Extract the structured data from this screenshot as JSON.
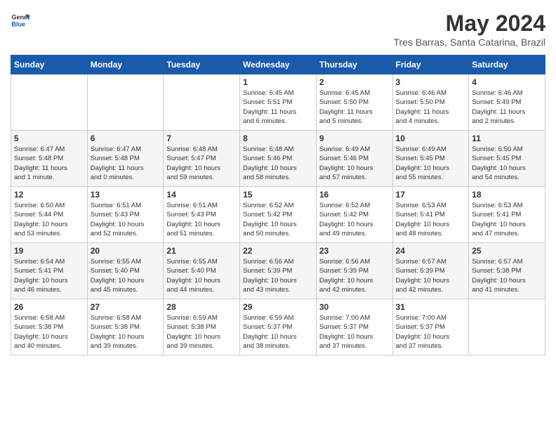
{
  "logo": {
    "text_general": "General",
    "text_blue": "Blue"
  },
  "title": "May 2024",
  "location": "Tres Barras, Santa Catarina, Brazil",
  "days_of_week": [
    "Sunday",
    "Monday",
    "Tuesday",
    "Wednesday",
    "Thursday",
    "Friday",
    "Saturday"
  ],
  "weeks": [
    [
      {
        "day": "",
        "info": ""
      },
      {
        "day": "",
        "info": ""
      },
      {
        "day": "",
        "info": ""
      },
      {
        "day": "1",
        "info": "Sunrise: 6:45 AM\nSunset: 5:51 PM\nDaylight: 11 hours\nand 6 minutes."
      },
      {
        "day": "2",
        "info": "Sunrise: 6:45 AM\nSunset: 5:50 PM\nDaylight: 11 hours\nand 5 minutes."
      },
      {
        "day": "3",
        "info": "Sunrise: 6:46 AM\nSunset: 5:50 PM\nDaylight: 11 hours\nand 4 minutes."
      },
      {
        "day": "4",
        "info": "Sunrise: 6:46 AM\nSunset: 5:49 PM\nDaylight: 11 hours\nand 2 minutes."
      }
    ],
    [
      {
        "day": "5",
        "info": "Sunrise: 6:47 AM\nSunset: 5:48 PM\nDaylight: 11 hours\nand 1 minute."
      },
      {
        "day": "6",
        "info": "Sunrise: 6:47 AM\nSunset: 5:48 PM\nDaylight: 11 hours\nand 0 minutes."
      },
      {
        "day": "7",
        "info": "Sunrise: 6:48 AM\nSunset: 5:47 PM\nDaylight: 10 hours\nand 59 minutes."
      },
      {
        "day": "8",
        "info": "Sunrise: 6:48 AM\nSunset: 5:46 PM\nDaylight: 10 hours\nand 58 minutes."
      },
      {
        "day": "9",
        "info": "Sunrise: 6:49 AM\nSunset: 5:46 PM\nDaylight: 10 hours\nand 57 minutes."
      },
      {
        "day": "10",
        "info": "Sunrise: 6:49 AM\nSunset: 5:45 PM\nDaylight: 10 hours\nand 55 minutes."
      },
      {
        "day": "11",
        "info": "Sunrise: 6:50 AM\nSunset: 5:45 PM\nDaylight: 10 hours\nand 54 minutes."
      }
    ],
    [
      {
        "day": "12",
        "info": "Sunrise: 6:50 AM\nSunset: 5:44 PM\nDaylight: 10 hours\nand 53 minutes."
      },
      {
        "day": "13",
        "info": "Sunrise: 6:51 AM\nSunset: 5:43 PM\nDaylight: 10 hours\nand 52 minutes."
      },
      {
        "day": "14",
        "info": "Sunrise: 6:51 AM\nSunset: 5:43 PM\nDaylight: 10 hours\nand 51 minutes."
      },
      {
        "day": "15",
        "info": "Sunrise: 6:52 AM\nSunset: 5:42 PM\nDaylight: 10 hours\nand 50 minutes."
      },
      {
        "day": "16",
        "info": "Sunrise: 6:52 AM\nSunset: 5:42 PM\nDaylight: 10 hours\nand 49 minutes."
      },
      {
        "day": "17",
        "info": "Sunrise: 6:53 AM\nSunset: 5:41 PM\nDaylight: 10 hours\nand 48 minutes."
      },
      {
        "day": "18",
        "info": "Sunrise: 6:53 AM\nSunset: 5:41 PM\nDaylight: 10 hours\nand 47 minutes."
      }
    ],
    [
      {
        "day": "19",
        "info": "Sunrise: 6:54 AM\nSunset: 5:41 PM\nDaylight: 10 hours\nand 46 minutes."
      },
      {
        "day": "20",
        "info": "Sunrise: 6:55 AM\nSunset: 5:40 PM\nDaylight: 10 hours\nand 45 minutes."
      },
      {
        "day": "21",
        "info": "Sunrise: 6:55 AM\nSunset: 5:40 PM\nDaylight: 10 hours\nand 44 minutes."
      },
      {
        "day": "22",
        "info": "Sunrise: 6:56 AM\nSunset: 5:39 PM\nDaylight: 10 hours\nand 43 minutes."
      },
      {
        "day": "23",
        "info": "Sunrise: 6:56 AM\nSunset: 5:39 PM\nDaylight: 10 hours\nand 42 minutes."
      },
      {
        "day": "24",
        "info": "Sunrise: 6:57 AM\nSunset: 5:39 PM\nDaylight: 10 hours\nand 42 minutes."
      },
      {
        "day": "25",
        "info": "Sunrise: 6:57 AM\nSunset: 5:38 PM\nDaylight: 10 hours\nand 41 minutes."
      }
    ],
    [
      {
        "day": "26",
        "info": "Sunrise: 6:58 AM\nSunset: 5:38 PM\nDaylight: 10 hours\nand 40 minutes."
      },
      {
        "day": "27",
        "info": "Sunrise: 6:58 AM\nSunset: 5:38 PM\nDaylight: 10 hours\nand 39 minutes."
      },
      {
        "day": "28",
        "info": "Sunrise: 6:59 AM\nSunset: 5:38 PM\nDaylight: 10 hours\nand 39 minutes."
      },
      {
        "day": "29",
        "info": "Sunrise: 6:59 AM\nSunset: 5:37 PM\nDaylight: 10 hours\nand 38 minutes."
      },
      {
        "day": "30",
        "info": "Sunrise: 7:00 AM\nSunset: 5:37 PM\nDaylight: 10 hours\nand 37 minutes."
      },
      {
        "day": "31",
        "info": "Sunrise: 7:00 AM\nSunset: 5:37 PM\nDaylight: 10 hours\nand 37 minutes."
      },
      {
        "day": "",
        "info": ""
      }
    ]
  ]
}
